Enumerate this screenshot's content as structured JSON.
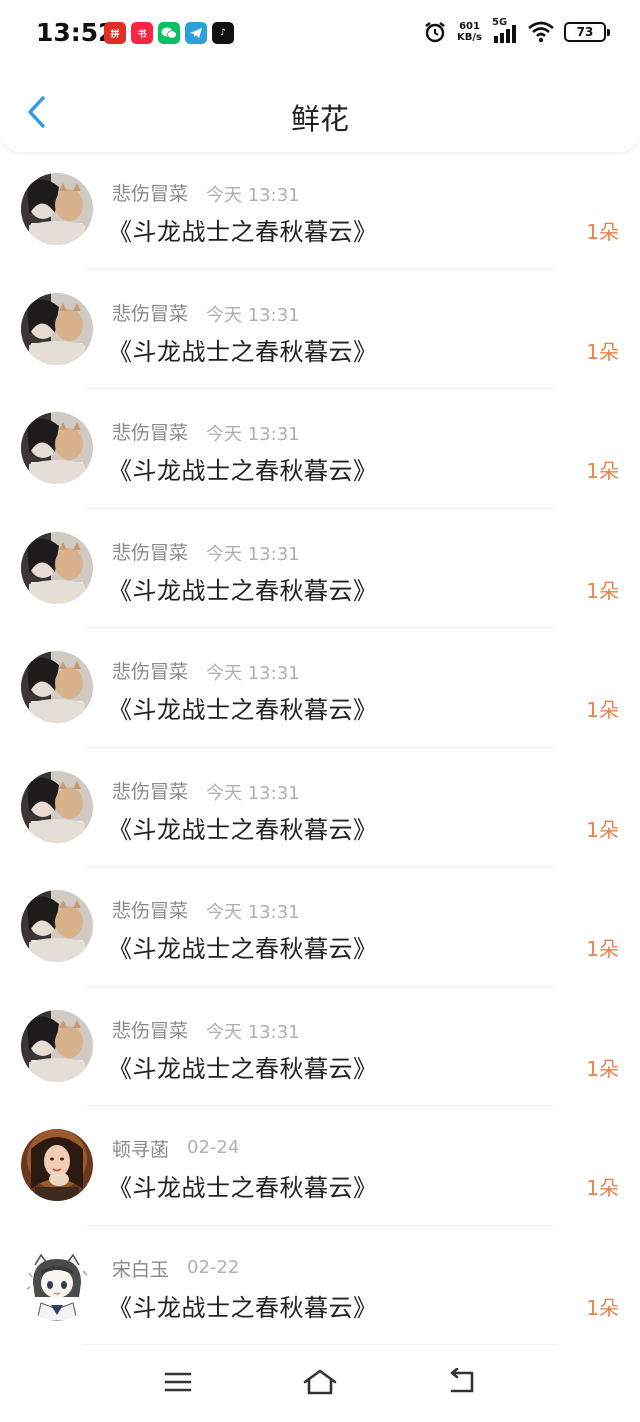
{
  "status_bar": {
    "time": "13:52",
    "net_speed_value": "601",
    "net_speed_unit": "KB/s",
    "signal_label": "5G",
    "battery": "73",
    "apps": [
      {
        "icon": "pinduoduo-icon",
        "color": "#e02e24"
      },
      {
        "icon": "xiaohongshu-icon",
        "color": "#ff2442"
      },
      {
        "icon": "wechat-icon",
        "color": "#07c160"
      },
      {
        "icon": "telegram-icon",
        "color": "#2aa1da"
      },
      {
        "icon": "tiktok-icon",
        "color": "#111111"
      }
    ]
  },
  "header": {
    "title": "鲜花",
    "back_icon": "chevron-left-icon",
    "accent_color": "#2f9be3"
  },
  "list": {
    "items": [
      {
        "user": "悲伤冒菜",
        "time": "今天 13:31",
        "title": "《斗龙战士之春秋暮云》",
        "count": "1朵",
        "avatar": "girl-cat-photo"
      },
      {
        "user": "悲伤冒菜",
        "time": "今天 13:31",
        "title": "《斗龙战士之春秋暮云》",
        "count": "1朵",
        "avatar": "girl-cat-photo"
      },
      {
        "user": "悲伤冒菜",
        "time": "今天 13:31",
        "title": "《斗龙战士之春秋暮云》",
        "count": "1朵",
        "avatar": "girl-cat-photo"
      },
      {
        "user": "悲伤冒菜",
        "time": "今天 13:31",
        "title": "《斗龙战士之春秋暮云》",
        "count": "1朵",
        "avatar": "girl-cat-photo"
      },
      {
        "user": "悲伤冒菜",
        "time": "今天 13:31",
        "title": "《斗龙战士之春秋暮云》",
        "count": "1朵",
        "avatar": "girl-cat-photo"
      },
      {
        "user": "悲伤冒菜",
        "time": "今天 13:31",
        "title": "《斗龙战士之春秋暮云》",
        "count": "1朵",
        "avatar": "girl-cat-photo"
      },
      {
        "user": "悲伤冒菜",
        "time": "今天 13:31",
        "title": "《斗龙战士之春秋暮云》",
        "count": "1朵",
        "avatar": "girl-cat-photo"
      },
      {
        "user": "悲伤冒菜",
        "time": "今天 13:31",
        "title": "《斗龙战士之春秋暮云》",
        "count": "1朵",
        "avatar": "girl-cat-photo"
      },
      {
        "user": "顿寻菡",
        "time": "02-24",
        "title": "《斗龙战士之春秋暮云》",
        "count": "1朵",
        "avatar": "woman-portrait-photo"
      },
      {
        "user": "宋白玉",
        "time": "02-22",
        "title": "《斗龙战士之春秋暮云》",
        "count": "1朵",
        "avatar": "anime-girl-drawing"
      }
    ]
  },
  "nav_bar": {
    "menu_icon": "menu-icon",
    "home_icon": "home-icon",
    "back_icon": "return-icon"
  }
}
